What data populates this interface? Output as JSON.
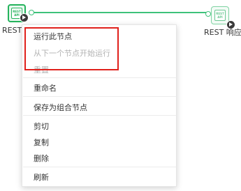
{
  "canvas": {
    "connector_color": "#3ec27a"
  },
  "nodes": {
    "source": {
      "glyph_text": "REST API",
      "caption": "REST",
      "icon": "rest-api-node-icon"
    },
    "target": {
      "glyph_text": "REST API",
      "caption": "REST 响应",
      "icon": "rest-api-node-icon"
    }
  },
  "context_menu": {
    "items": [
      {
        "label": "运行此节点",
        "enabled": true
      },
      {
        "label": "从下一个节点开始运行",
        "enabled": false
      },
      {
        "label": "重置",
        "enabled": false
      },
      {
        "label": "重命名",
        "enabled": true
      },
      {
        "label": "保存为组合节点",
        "enabled": true
      },
      {
        "label": "剪切",
        "enabled": true
      },
      {
        "label": "复制",
        "enabled": true
      },
      {
        "label": "删除",
        "enabled": true
      },
      {
        "label": "刷新",
        "enabled": true
      }
    ],
    "highlight_color": "#e0201b"
  }
}
